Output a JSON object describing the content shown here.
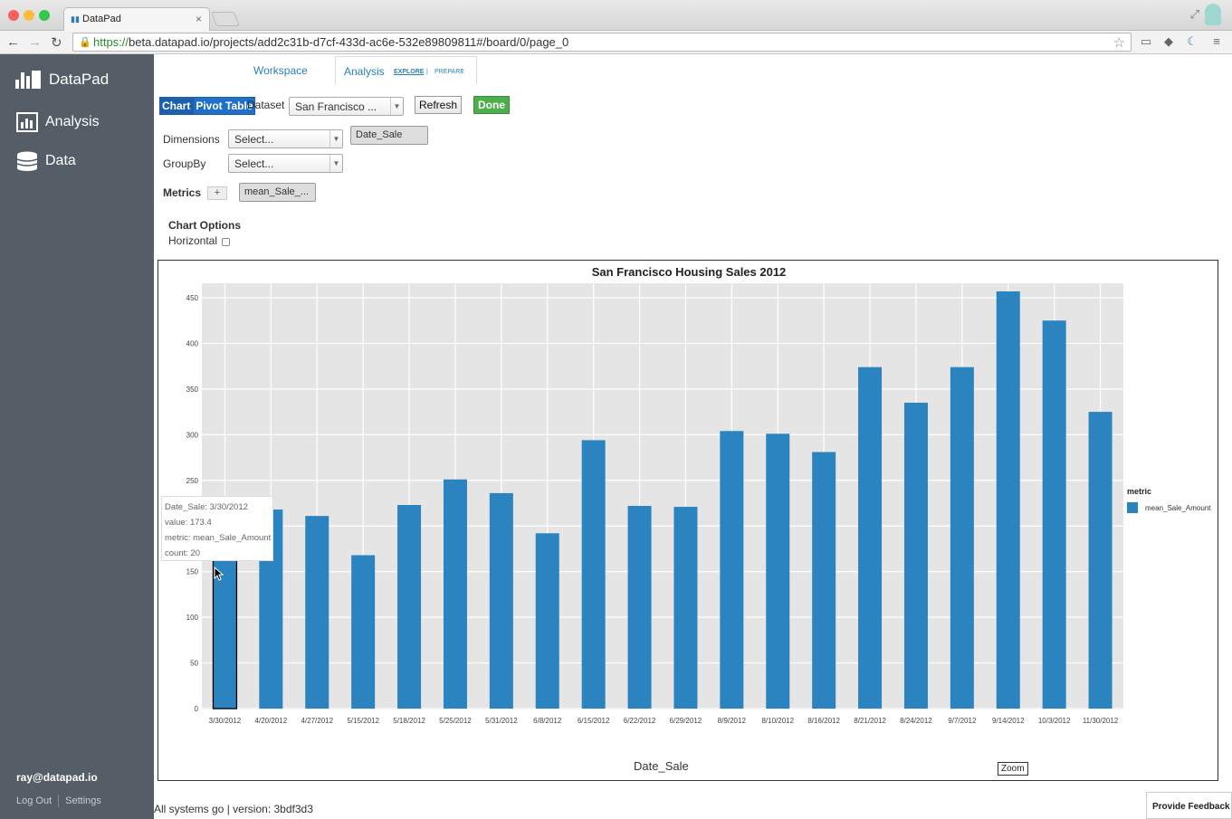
{
  "browser": {
    "tab_title": "DataPad",
    "url_https": "https://",
    "url_rest": "beta.datapad.io/projects/add2c31b-d7cf-433d-ac6e-532e89809811#/board/0/page_0"
  },
  "sidebar": {
    "brand": "DataPad",
    "items": [
      {
        "label": "Analysis",
        "icon": "bar-chart-icon"
      },
      {
        "label": "Data",
        "icon": "database-icon"
      }
    ],
    "user_email": "ray@datapad.io",
    "logout_label": "Log Out",
    "settings_label": "Settings"
  },
  "top_tabs": {
    "workspace": "Workspace",
    "analysis": "Analysis",
    "explore": "EXPLORE",
    "divider": "|",
    "prepare": "PREPARE"
  },
  "controls": {
    "chart_btn": "Chart",
    "pivot_btn": "Pivot Table",
    "dataset_label": "Dataset",
    "dataset_value": "San Francisco ...",
    "refresh_btn": "Refresh",
    "done_btn": "Done",
    "dimensions_label": "Dimensions",
    "dimensions_select": "Select...",
    "dimension_chip": "Date_Sale",
    "groupby_label": "GroupBy",
    "groupby_select": "Select...",
    "metrics_label": "Metrics",
    "metrics_add": "+",
    "metric_chip": "mean_Sale_...",
    "chart_options_label": "Chart Options",
    "horizontal_label": "Horizontal"
  },
  "tooltip": {
    "line1": "Date_Sale: 3/30/2012",
    "line2": "value: 173.4",
    "line3": "metric: mean_Sale_Amount",
    "line4": "count: 20"
  },
  "zoom_label": "Zoom",
  "status_text": "All systems go | version: 3bdf3d3",
  "feedback_label": "Provide Feedback",
  "colors": {
    "bar": "#2b84bf",
    "sidebar": "#555e66",
    "plot_bg": "#e5e5e5"
  },
  "chart_data": {
    "type": "bar",
    "title": "San Francisco Housing Sales 2012",
    "xlabel": "Date_Sale",
    "ylabel": "",
    "legend_title": "metric",
    "legend_position": "right",
    "grid": true,
    "ylim": [
      0,
      465
    ],
    "yticks": [
      0,
      50,
      100,
      150,
      200,
      250,
      300,
      350,
      400,
      450
    ],
    "categories": [
      "3/30/2012",
      "4/20/2012",
      "4/27/2012",
      "5/15/2012",
      "5/18/2012",
      "5/25/2012",
      "5/31/2012",
      "6/8/2012",
      "6/15/2012",
      "6/22/2012",
      "6/29/2012",
      "8/9/2012",
      "8/10/2012",
      "8/16/2012",
      "8/21/2012",
      "8/24/2012",
      "9/7/2012",
      "9/14/2012",
      "10/3/2012",
      "11/30/2012"
    ],
    "series": [
      {
        "name": "mean_Sale_Amount",
        "values": [
          173.4,
          218,
          211,
          168,
          223,
          251,
          236,
          192,
          294,
          222,
          221,
          304,
          301,
          281,
          374,
          335,
          374,
          457,
          425,
          325
        ]
      }
    ]
  }
}
